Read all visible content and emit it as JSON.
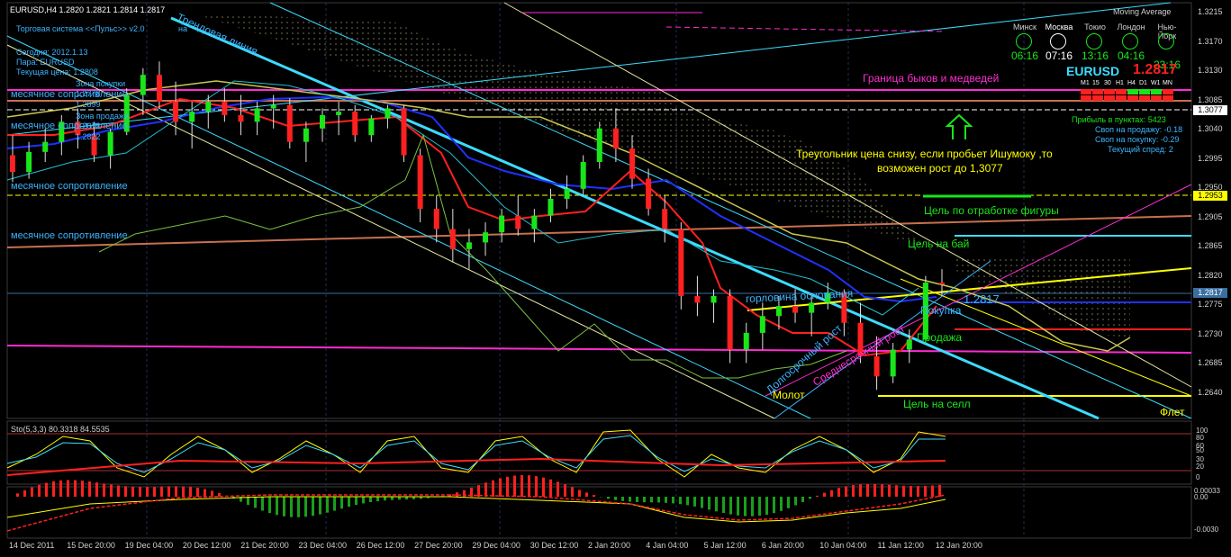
{
  "header": {
    "symbol_line": "EURUSD,H4  1.2820 1.2821 1.2814 1.2817",
    "system_title": "Торговая система <<Пульс>> v2.0",
    "system_suffix": "на",
    "today_label": "Сегодня:  2012.1.13",
    "pair_label": "Пара:  EURUSD",
    "price_label": "Текущая цена: 1.2808",
    "indicator_name": "Moving Average"
  },
  "left_panel": {
    "buy_zone": "Зона покупки",
    "buy_level_1": "1.2778",
    "buy_level_2": "1.2899",
    "sell_zone": "Зона продажи",
    "sell_level_1": "1.2672",
    "sell_level_2": "1.2822",
    "resistance_1": "месячное сопротивление",
    "resistance_2": "месячное сопротивление",
    "resistance_3": "месячное сопротивление",
    "resistance_4": "месячное сопротивление"
  },
  "clocks": [
    {
      "city": "Минск",
      "time": "06:16"
    },
    {
      "city": "Москва",
      "time": "07:16"
    },
    {
      "city": "Токио",
      "time": "13:16"
    },
    {
      "city": "Лондон",
      "time": "04:16"
    },
    {
      "city": "Нью-Йорк",
      "time": "23:16"
    }
  ],
  "info_panel": {
    "pair": "EURUSD",
    "price": "1.2817",
    "timeframes": [
      "M1",
      "15",
      "30",
      "H1",
      "H4",
      "D1",
      "W1",
      "MN"
    ],
    "profit": "Прибыль в пунктах: 5423",
    "swap_sell": "Своп на продажу: -0.18",
    "swap_buy": "Своп на покупку: -0.29",
    "spread": "Текущий спред: 2"
  },
  "annotations": {
    "bull_bear": "Граница быков и медведей",
    "triangle_1": "Треугольник цена снизу, если пробьет Ишумоку ,то",
    "triangle_2": "возможен рост до 1,3077",
    "target_figure": "Цель по отработке фигуры",
    "target_buy": "Цель на бай",
    "base_neck": "горловина основания",
    "buy": "Покупка",
    "sell": "Продажа",
    "price_mark": "1.2817",
    "hammer": "Молот",
    "target_sell": "Цель на селл",
    "flat": "Флет",
    "trend_line": "Трендовая линия",
    "long_growth": "Долгосрочный рост",
    "medium_growth": "Среднесрочный рост"
  },
  "price_axis": {
    "ticks": [
      "1.3215",
      "1.3170",
      "1.3130",
      "1.3085",
      "1.3040",
      "1.2995",
      "1.2950",
      "1.2905",
      "1.2865",
      "1.2820",
      "1.2775",
      "1.2730",
      "1.2685",
      "1.2640"
    ],
    "tag_1": "1.3077",
    "tag_2": "1.2953",
    "tag_3": "1.2817"
  },
  "stoch": {
    "label": "Sto(5,3,3) 80.3318 84.5535",
    "levels": [
      "100",
      "80",
      "60",
      "50",
      "30",
      "20",
      "0"
    ]
  },
  "macd": {
    "levels": [
      "0.00033",
      "0.00",
      "-0.0030"
    ]
  },
  "time_axis": [
    "14 Dec 2011",
    "15 Dec 20:00",
    "19 Dec 04:00",
    "20 Dec 12:00",
    "21 Dec 20:00",
    "23 Dec 04:00",
    "26 Dec 12:00",
    "27 Dec 20:00",
    "29 Dec 04:00",
    "30 Dec 12:00",
    "2 Jan 20:00",
    "4 Jan 04:00",
    "5 Jan 12:00",
    "6 Jan 20:00",
    "10 Jan 04:00",
    "11 Jan 12:00",
    "12 Jan 20:00"
  ],
  "chart_data": {
    "type": "candlestick",
    "title": "EURUSD,H4",
    "ylim": [
      1.262,
      1.3235
    ],
    "candles": [
      [
        1.301,
        1.304,
        1.297,
        1.2985
      ],
      [
        1.2985,
        1.303,
        1.2975,
        1.3015
      ],
      [
        1.3015,
        1.305,
        1.3,
        1.303
      ],
      [
        1.303,
        1.307,
        1.301,
        1.306
      ],
      [
        1.306,
        1.308,
        1.302,
        1.304
      ],
      [
        1.304,
        1.306,
        1.3,
        1.301
      ],
      [
        1.301,
        1.305,
        1.299,
        1.3045
      ],
      [
        1.3045,
        1.311,
        1.304,
        1.31
      ],
      [
        1.31,
        1.314,
        1.307,
        1.313
      ],
      [
        1.313,
        1.315,
        1.308,
        1.309
      ],
      [
        1.309,
        1.312,
        1.304,
        1.306
      ],
      [
        1.306,
        1.309,
        1.302,
        1.3075
      ],
      [
        1.3075,
        1.31,
        1.305,
        1.309
      ],
      [
        1.309,
        1.311,
        1.306,
        1.307
      ],
      [
        1.307,
        1.31,
        1.304,
        1.306
      ],
      [
        1.306,
        1.309,
        1.304,
        1.308
      ],
      [
        1.308,
        1.31,
        1.305,
        1.3085
      ],
      [
        1.3085,
        1.3095,
        1.302,
        1.303
      ],
      [
        1.303,
        1.306,
        1.3,
        1.305
      ],
      [
        1.305,
        1.308,
        1.303,
        1.307
      ],
      [
        1.307,
        1.309,
        1.304,
        1.3075
      ],
      [
        1.3075,
        1.3085,
        1.303,
        1.304
      ],
      [
        1.304,
        1.307,
        1.303,
        1.3065
      ],
      [
        1.3065,
        1.3085,
        1.305,
        1.308
      ],
      [
        1.308,
        1.3085,
        1.3,
        1.301
      ],
      [
        1.301,
        1.302,
        1.291,
        1.293
      ],
      [
        1.293,
        1.295,
        1.288,
        1.29
      ],
      [
        1.29,
        1.293,
        1.285,
        1.287
      ],
      [
        1.287,
        1.29,
        1.284,
        1.288
      ],
      [
        1.288,
        1.291,
        1.286,
        1.2895
      ],
      [
        1.2895,
        1.293,
        1.288,
        1.292
      ],
      [
        1.292,
        1.295,
        1.289,
        1.29
      ],
      [
        1.29,
        1.293,
        1.288,
        1.292
      ],
      [
        1.292,
        1.296,
        1.291,
        1.2945
      ],
      [
        1.2945,
        1.298,
        1.293,
        1.296
      ],
      [
        1.296,
        1.301,
        1.295,
        1.3
      ],
      [
        1.3,
        1.306,
        1.299,
        1.305
      ],
      [
        1.305,
        1.308,
        1.3,
        1.302
      ],
      [
        1.302,
        1.304,
        1.296,
        1.2975
      ],
      [
        1.2975,
        1.299,
        1.292,
        1.293
      ],
      [
        1.293,
        1.295,
        1.288,
        1.29
      ],
      [
        1.29,
        1.291,
        1.278,
        1.28
      ],
      [
        1.28,
        1.283,
        1.277,
        1.279
      ],
      [
        1.279,
        1.281,
        1.276,
        1.28
      ],
      [
        1.28,
        1.281,
        1.27,
        1.272
      ],
      [
        1.272,
        1.276,
        1.27,
        1.2745
      ],
      [
        1.2745,
        1.279,
        1.272,
        1.277
      ],
      [
        1.277,
        1.28,
        1.275,
        1.2785
      ],
      [
        1.2785,
        1.281,
        1.276,
        1.2775
      ],
      [
        1.2775,
        1.28,
        1.274,
        1.279
      ],
      [
        1.279,
        1.282,
        1.278,
        1.2805
      ],
      [
        1.2805,
        1.281,
        1.274,
        1.276
      ],
      [
        1.276,
        1.279,
        1.27,
        1.271
      ],
      [
        1.271,
        1.274,
        1.266,
        1.268
      ],
      [
        1.268,
        1.273,
        1.267,
        1.272
      ],
      [
        1.272,
        1.275,
        1.27,
        1.2735
      ],
      [
        1.2735,
        1.283,
        1.273,
        1.282
      ],
      [
        1.282,
        1.284,
        1.28,
        1.2817
      ]
    ]
  }
}
